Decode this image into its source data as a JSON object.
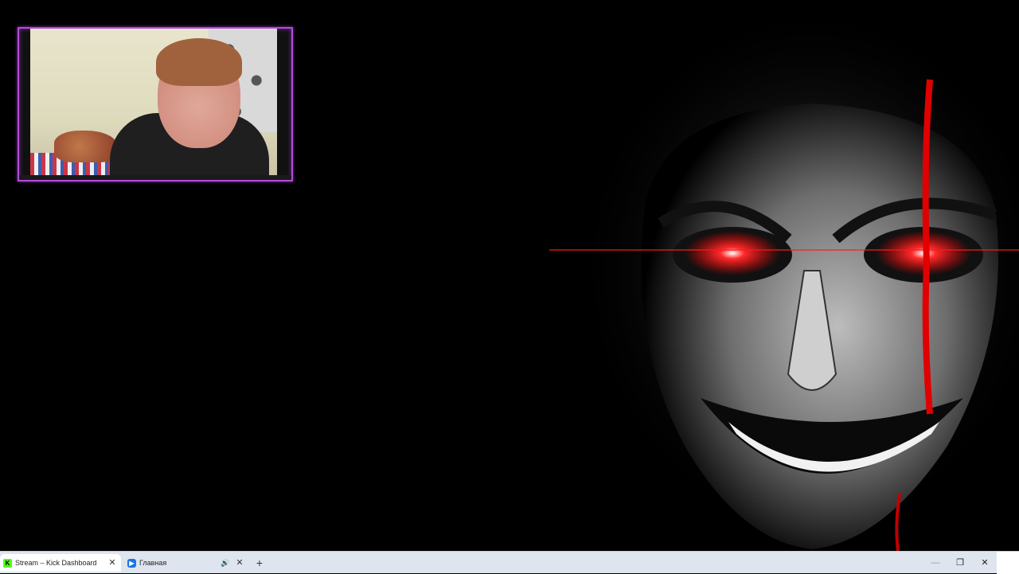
{
  "tabs": [
    {
      "label": "Stream – Kick Dashboard",
      "favicon": "kick-icon",
      "active": true,
      "close": "✕"
    },
    {
      "label": "Главная",
      "favicon": "home-icon",
      "active": false,
      "audio": "🔊",
      "close": "✕"
    }
  ],
  "new_tab": "+",
  "window_controls": {
    "minimize": "—",
    "maximize": "❐",
    "close": "✕"
  },
  "colors": {
    "webcam_border": "#b04dd6",
    "eye_glow": "#ff1a1a",
    "tabstrip_bg": "#dfe5ee",
    "kick_green": "#53fc18"
  }
}
